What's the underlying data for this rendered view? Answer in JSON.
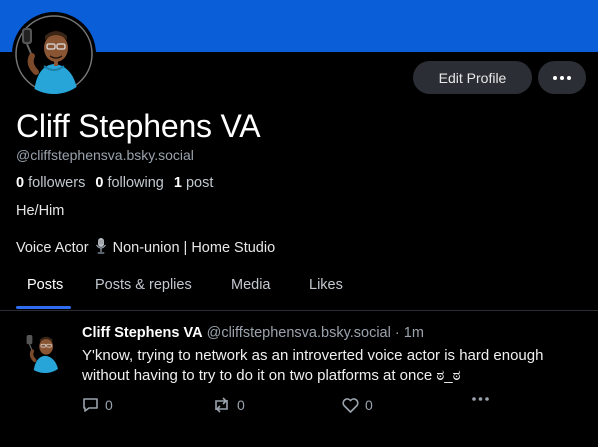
{
  "profile": {
    "display_name": "Cliff Stephens VA",
    "handle": "@cliffstephensva.bsky.social",
    "followers_count": "0",
    "followers_label": "followers",
    "following_count": "0",
    "following_label": "following",
    "posts_count": "1",
    "posts_label": "post",
    "pronouns": "He/Him",
    "bio_before": "Voice Actor",
    "bio_after": "Non-union | Home Studio",
    "bio_emoji": "microphone-icon",
    "banner_color": "#0a5fd9"
  },
  "actions": {
    "edit_profile_label": "Edit Profile",
    "more_icon": "ellipsis-icon"
  },
  "tabs": [
    {
      "label": "Posts",
      "active": true
    },
    {
      "label": "Posts & replies",
      "active": false
    },
    {
      "label": "Media",
      "active": false
    },
    {
      "label": "Likes",
      "active": false
    }
  ],
  "post": {
    "author": "Cliff Stephens VA",
    "handle": "@cliffstephensva.bsky.social",
    "separator": "·",
    "time": "1m",
    "text": "Y'know, trying to network as an introverted voice actor is hard enough without having to try to do it on two platforms at once ಠ_ಠ",
    "reply_count": "0",
    "repost_count": "0",
    "like_count": "0"
  },
  "colors": {
    "accent": "#2e6df0",
    "background": "#000000",
    "button_bg": "#2b2f35",
    "muted_text": "#9aa3ad"
  }
}
